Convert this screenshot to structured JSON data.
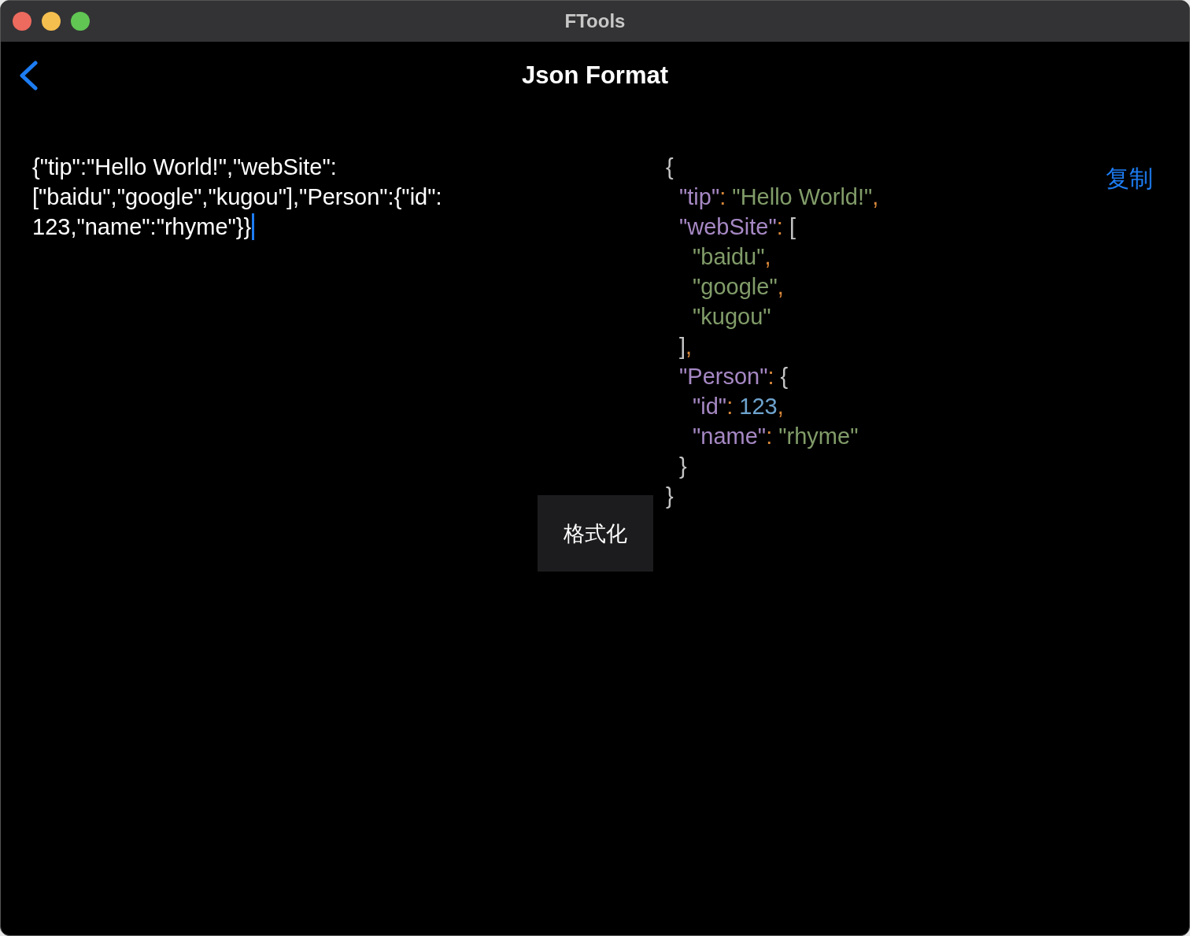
{
  "window": {
    "title": "FTools"
  },
  "nav": {
    "title": "Json Format"
  },
  "input": {
    "value": "{\"tip\":\"Hello World!\",\"webSite\":[\"baidu\",\"google\",\"kugou\"],\"Person\":{\"id\":123,\"name\":\"rhyme\"}}"
  },
  "format_button": {
    "label": "格式化"
  },
  "copy_link": {
    "label": "复制"
  },
  "output": {
    "lines": [
      {
        "tokens": [
          {
            "kind": "bracket",
            "text": "{"
          }
        ],
        "children": [
          {
            "tokens": [
              {
                "kind": "key",
                "text": "\"tip\""
              },
              {
                "kind": "punct",
                "text": ": "
              },
              {
                "kind": "string",
                "text": "\"Hello World!\""
              },
              {
                "kind": "punct",
                "text": ","
              }
            ]
          },
          {
            "tokens": [
              {
                "kind": "key",
                "text": "\"webSite\""
              },
              {
                "kind": "punct",
                "text": ": "
              },
              {
                "kind": "bracket",
                "text": "["
              }
            ],
            "children": [
              {
                "tokens": [
                  {
                    "kind": "string",
                    "text": "\"baidu\""
                  },
                  {
                    "kind": "punct",
                    "text": ","
                  }
                ]
              },
              {
                "tokens": [
                  {
                    "kind": "string",
                    "text": "\"google\""
                  },
                  {
                    "kind": "punct",
                    "text": ","
                  }
                ]
              },
              {
                "tokens": [
                  {
                    "kind": "string",
                    "text": "\"kugou\""
                  }
                ]
              }
            ]
          },
          {
            "tokens": [
              {
                "kind": "bracket",
                "text": "]"
              },
              {
                "kind": "punct",
                "text": ","
              }
            ]
          },
          {
            "tokens": [
              {
                "kind": "key",
                "text": "\"Person\""
              },
              {
                "kind": "punct",
                "text": ": "
              },
              {
                "kind": "bracket",
                "text": "{"
              }
            ],
            "children": [
              {
                "tokens": [
                  {
                    "kind": "key",
                    "text": "\"id\""
                  },
                  {
                    "kind": "punct",
                    "text": ": "
                  },
                  {
                    "kind": "number",
                    "text": "123"
                  },
                  {
                    "kind": "punct",
                    "text": ","
                  }
                ]
              },
              {
                "tokens": [
                  {
                    "kind": "key",
                    "text": "\"name\""
                  },
                  {
                    "kind": "punct",
                    "text": ": "
                  },
                  {
                    "kind": "string",
                    "text": "\"rhyme\""
                  }
                ]
              }
            ]
          },
          {
            "tokens": [
              {
                "kind": "bracket",
                "text": "}"
              }
            ]
          }
        ]
      },
      {
        "tokens": [
          {
            "kind": "bracket",
            "text": "}"
          }
        ]
      }
    ]
  }
}
